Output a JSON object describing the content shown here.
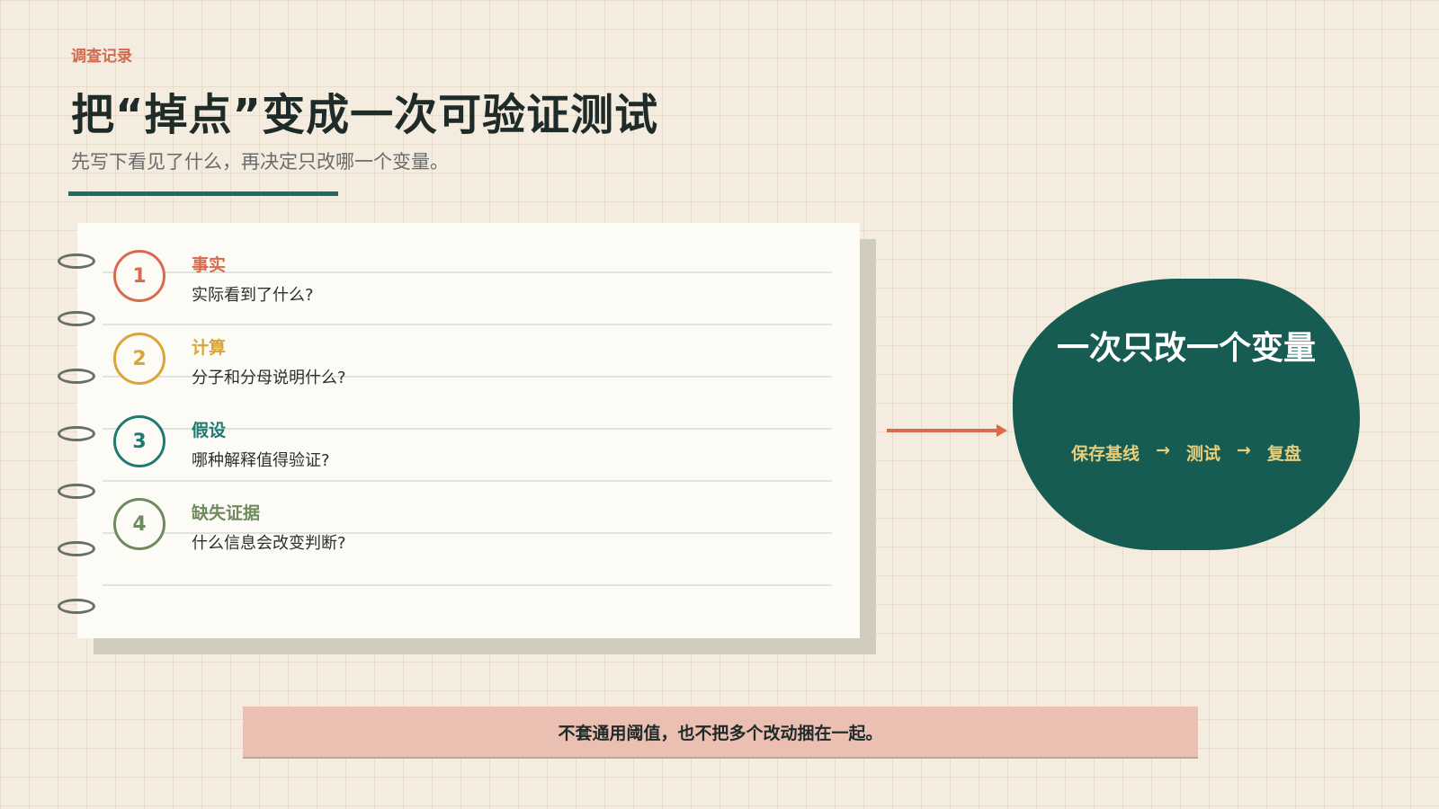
{
  "header": {
    "kicker": "调查记录",
    "title": "把“掉点”变成一次可验证测试",
    "subtitle": "先写下看见了什么，再决定只改哪一个变量。"
  },
  "notebook": {
    "items": [
      {
        "number": "1",
        "title": "事实",
        "desc": "实际看到了什么?",
        "color": "#d86a4e"
      },
      {
        "number": "2",
        "title": "计算",
        "desc": "分子和分母说明什么?",
        "color": "#d9a53a"
      },
      {
        "number": "3",
        "title": "假设",
        "desc": "哪种解释值得验证?",
        "color": "#1f7a6f"
      },
      {
        "number": "4",
        "title": "缺失证据",
        "desc": "什么信息会改变判断?",
        "color": "#6f8a5e"
      }
    ]
  },
  "callout": {
    "title": "一次只改一个变量",
    "flow": [
      "保存基线",
      "测试",
      "复盘"
    ],
    "arrow_glyph": "→"
  },
  "footer_note": "不套通用阈值，也不把多个改动捆在一起。",
  "colors": {
    "accent": "#d86a4e",
    "primary": "#165c52",
    "gold": "#e7cf7c",
    "note_bg": "#ebbfb2"
  }
}
